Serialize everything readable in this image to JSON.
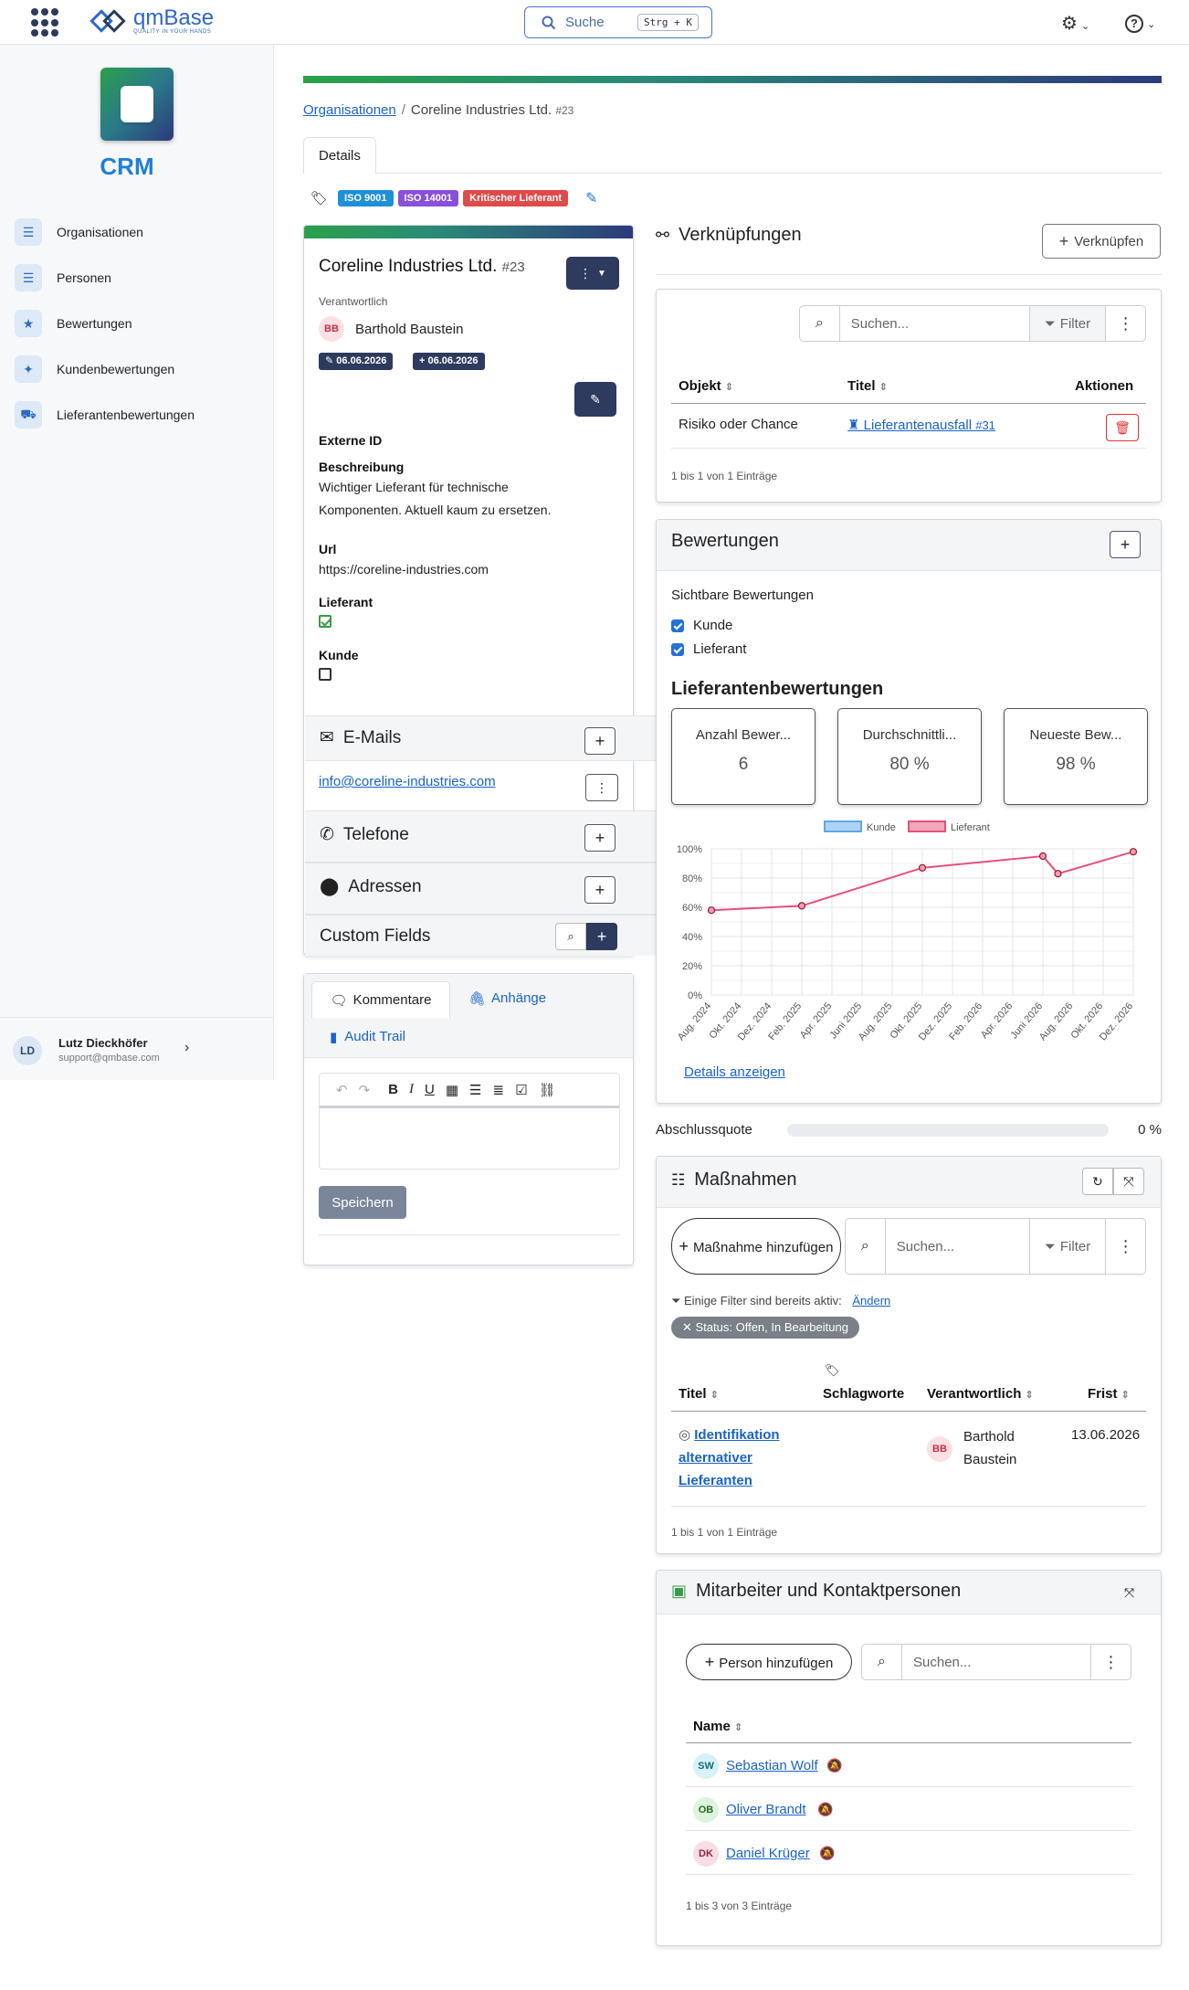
{
  "topbar": {
    "logo_text": "qmBase",
    "logo_tagline": "QUALITY IN YOUR HANDS",
    "search_label": "Suche",
    "search_shortcut": "Strg + K"
  },
  "sidebar": {
    "app_title": "CRM",
    "items": [
      {
        "label": "Organisationen",
        "icon": "list-icon"
      },
      {
        "label": "Personen",
        "icon": "list-icon"
      },
      {
        "label": "Bewertungen",
        "icon": "star-icon"
      },
      {
        "label": "Kundenbewertungen",
        "icon": "user-star-icon"
      },
      {
        "label": "Lieferantenbewertungen",
        "icon": "truck-icon"
      }
    ],
    "user": {
      "initials": "LD",
      "name": "Lutz Dieckhöfer",
      "email": "support@qmbase.com"
    }
  },
  "breadcrumb": {
    "root": "Organisationen",
    "current": "Coreline Industries Ltd.",
    "current_id": "#23"
  },
  "tabs": {
    "active": "Details"
  },
  "tags": [
    {
      "label": "ISO 9001",
      "color": "#1f8fd8"
    },
    {
      "label": "ISO 14001",
      "color": "#8a4fd8"
    },
    {
      "label": "Kritischer Lieferant",
      "color": "#e04a4a"
    }
  ],
  "org": {
    "name": "Coreline Industries Ltd.",
    "id": "#23",
    "responsible_label": "Verantwortlich",
    "responsible_initials": "BB",
    "responsible_name": "Barthold Baustein",
    "updated": "06.06.2026",
    "created": "06.06.2026",
    "external_id_label": "Externe ID",
    "description_label": "Beschreibung",
    "description_line1": "Wichtiger Lieferant für technische",
    "description_line2": "Komponenten. Aktuell kaum zu ersetzen.",
    "url_label": "Url",
    "url": "https://coreline-industries.com",
    "supplier_label": "Lieferant",
    "customer_label": "Kunde",
    "emails_label": "E-Mails",
    "email": "info@coreline-industries.com",
    "phones_label": "Telefone",
    "addresses_label": "Adressen",
    "custom_fields_label": "Custom Fields"
  },
  "comments": {
    "tab_comments": "Kommentare",
    "tab_attachments": "Anhänge",
    "tab_audit": "Audit Trail",
    "save_label": "Speichern"
  },
  "links": {
    "title": "Verknüpfungen",
    "add_label": "Verknüpfen",
    "search_placeholder": "Suchen...",
    "filter_label": "Filter",
    "headers": [
      "Objekt",
      "Titel",
      "Aktionen"
    ],
    "rows": [
      {
        "object": "Risiko oder Chance",
        "title": "Lieferantenausfall",
        "title_id": "#31"
      }
    ],
    "footer": "1 bis 1 von 1 Einträge"
  },
  "ratings": {
    "title": "Bewertungen",
    "visible_label": "Sichtbare Bewertungen",
    "opt_customer": "Kunde",
    "opt_supplier": "Lieferant",
    "supplier_ratings_title": "Lieferantenbewertungen",
    "stats": [
      {
        "label": "Anzahl Bewer...",
        "value": "6"
      },
      {
        "label": "Durchschnittli...",
        "value": "80 %"
      },
      {
        "label": "Neueste Bew...",
        "value": "98 %"
      }
    ],
    "details_link": "Details anzeigen"
  },
  "chart_data": {
    "type": "line",
    "x": [
      "Aug. 2024",
      "Okt. 2024",
      "Dez. 2024",
      "Feb. 2025",
      "Apr. 2025",
      "Juni 2025",
      "Aug. 2025",
      "Okt. 2025",
      "Dez. 2025",
      "Feb. 2026",
      "Apr. 2026",
      "Juni 2026",
      "Aug. 2026",
      "Okt. 2026",
      "Dez. 2026"
    ],
    "yticks": [
      "100%",
      "80%",
      "60%",
      "40%",
      "20%",
      "0%"
    ],
    "ylim": [
      0,
      100
    ],
    "series": [
      {
        "name": "Kunde",
        "color": "#5aa8e8",
        "points": []
      },
      {
        "name": "Lieferant",
        "color": "#e8507a",
        "points": [
          {
            "x": "Aug. 2024",
            "y": 58
          },
          {
            "x": "Feb. 2025",
            "y": 61
          },
          {
            "x": "Okt. 2025",
            "y": 87
          },
          {
            "x": "Juni 2026",
            "y": 95
          },
          {
            "x": "Juli 2026",
            "y": 83
          },
          {
            "x": "Dez. 2026",
            "y": 98
          }
        ]
      }
    ],
    "legend": "top",
    "grid": true
  },
  "completion": {
    "label": "Abschlussquote",
    "value": "0 %",
    "fraction": 0
  },
  "measures": {
    "title": "Maßnahmen",
    "add_label": "Maßnahme hinzufügen",
    "search_placeholder": "Suchen...",
    "filter_label": "Filter",
    "filter_note": "Einige Filter sind bereits aktiv:",
    "change_link": "Ändern",
    "status_badge": "Status: Offen, In Bearbeitung",
    "headers": [
      "Titel",
      "Schlagworte",
      "Verantwortlich",
      "Frist"
    ],
    "rows": [
      {
        "title": "Identifikation alternativer Lieferanten",
        "initials": "BB",
        "owner": "Barthold Baustein",
        "due": "13.06.2026"
      }
    ],
    "footer": "1 bis 1 von 1 Einträge"
  },
  "staff": {
    "title": "Mitarbeiter und Kontaktpersonen",
    "add_label": "Person hinzufügen",
    "search_placeholder": "Suchen...",
    "header_name": "Name",
    "people": [
      {
        "initials": "SW",
        "name": "Sebastian Wolf",
        "bg": "#d6f2f6",
        "fg": "#1a6a7a"
      },
      {
        "initials": "OB",
        "name": "Oliver Brandt",
        "bg": "#dcf3dc",
        "fg": "#2a6a2a"
      },
      {
        "initials": "DK",
        "name": "Daniel Krüger",
        "bg": "#f9dce4",
        "fg": "#8a2a4a"
      }
    ],
    "footer": "1 bis 3 von 3 Einträge"
  }
}
